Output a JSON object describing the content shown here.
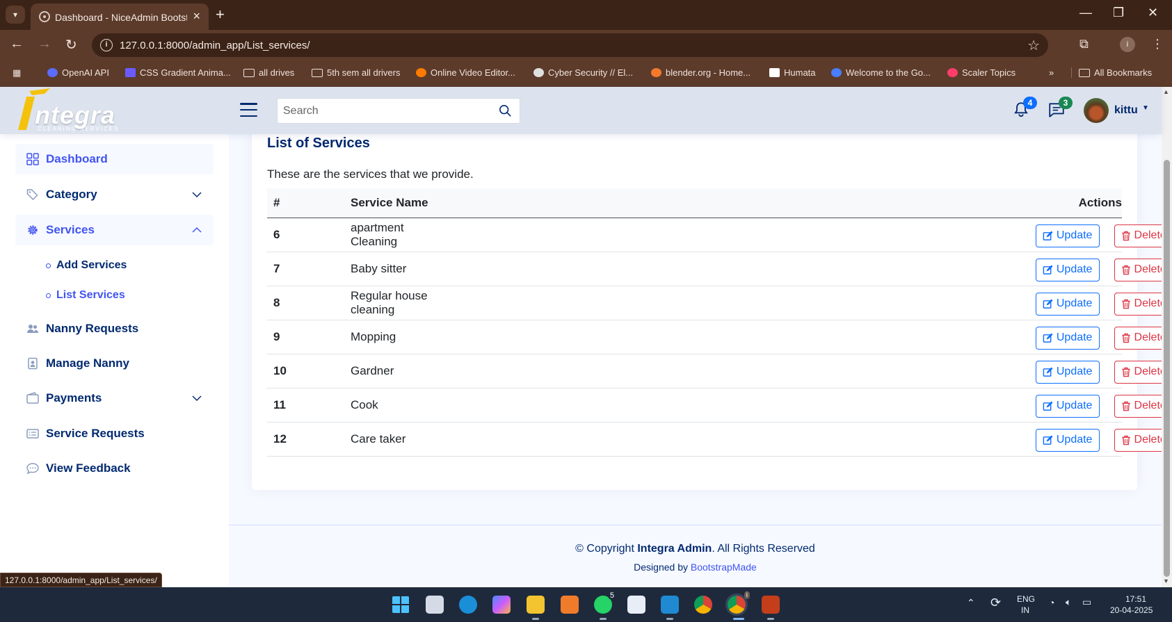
{
  "browser": {
    "tab_title": "Dashboard - NiceAdmin Bootstrap Template",
    "url": "127.0.0.1:8000/admin_app/List_services/",
    "status_url": "127.0.0.1:8000/admin_app/List_services/",
    "bookmarks": [
      {
        "label": "OpenAI API",
        "icon": "openai-icon",
        "color": "#5b6cff"
      },
      {
        "label": "CSS Gradient Anima...",
        "icon": "css-gradient-icon",
        "color": "#6b5bff"
      },
      {
        "label": "all drives",
        "icon": "folder-icon",
        "color": ""
      },
      {
        "label": "5th sem all drivers",
        "icon": "folder-icon",
        "color": ""
      },
      {
        "label": "Online Video Editor...",
        "icon": "video-editor-icon",
        "color": "#ff7a00"
      },
      {
        "label": "Cyber Security // El...",
        "icon": "cyber-security-icon",
        "color": "#e0e0e0"
      },
      {
        "label": "blender.org - Home...",
        "icon": "blender-icon",
        "color": "#f5792a"
      },
      {
        "label": "Humata",
        "icon": "humata-icon",
        "color": "#ffffff"
      },
      {
        "label": "Welcome to the Go...",
        "icon": "google-c-icon",
        "color": "#4a7dff"
      },
      {
        "label": "Scaler Topics",
        "icon": "scaler-icon",
        "color": "#ff3d6a"
      }
    ],
    "all_bookmarks": "All Bookmarks",
    "profile_letter": "i"
  },
  "header": {
    "logo_text": "ntegra",
    "logo_sub": "CLEANING  SERVICES",
    "search_placeholder": "Search",
    "notifications_count": "4",
    "messages_count": "3",
    "user_name": "kittu"
  },
  "sidebar": {
    "items": [
      {
        "label": "Dashboard",
        "icon": "grid-icon"
      },
      {
        "label": "Category",
        "icon": "tags-icon"
      },
      {
        "label": "Services",
        "icon": "gear-icon"
      },
      {
        "label": "Nanny Requests",
        "icon": "people-icon"
      },
      {
        "label": "Manage Nanny",
        "icon": "person-badge-icon"
      },
      {
        "label": "Payments",
        "icon": "wallet-icon"
      },
      {
        "label": "Service Requests",
        "icon": "card-list-icon"
      },
      {
        "label": "View Feedback",
        "icon": "chat-dots-icon"
      }
    ],
    "sub_items": [
      {
        "label": "Add Services"
      },
      {
        "label": "List Services"
      }
    ]
  },
  "main": {
    "title": "List of Services",
    "description": "These are the services that we provide.",
    "columns": [
      "#",
      "Service Name",
      "Actions"
    ],
    "rows": [
      {
        "id": "6",
        "name": "apartment Cleaning"
      },
      {
        "id": "7",
        "name": "Baby sitter"
      },
      {
        "id": "8",
        "name": "Regular house cleaning"
      },
      {
        "id": "9",
        "name": "Mopping"
      },
      {
        "id": "10",
        "name": "Gardner"
      },
      {
        "id": "11",
        "name": "Cook"
      },
      {
        "id": "12",
        "name": "Care taker"
      }
    ],
    "update_label": "Update",
    "delete_label": "Delete"
  },
  "footer": {
    "copyright_prefix": "© Copyright",
    "brand": "Integra Admin",
    "rights": ". All Rights Reserved",
    "designed_by": "Designed by",
    "designer": "BootstrapMade"
  },
  "taskbar": {
    "whatsapp_badge": "5",
    "chrome_badge": "i",
    "lang_top": "ENG",
    "lang_bottom": "IN",
    "time": "17:51",
    "date": "20-04-2025"
  },
  "colors": {
    "brand_dark": "#012970",
    "accent": "#4154f1",
    "update_blue": "#0d6efd",
    "delete_red": "#dc3545",
    "notif_badge": "#0d6efd",
    "msg_badge": "#198754"
  }
}
